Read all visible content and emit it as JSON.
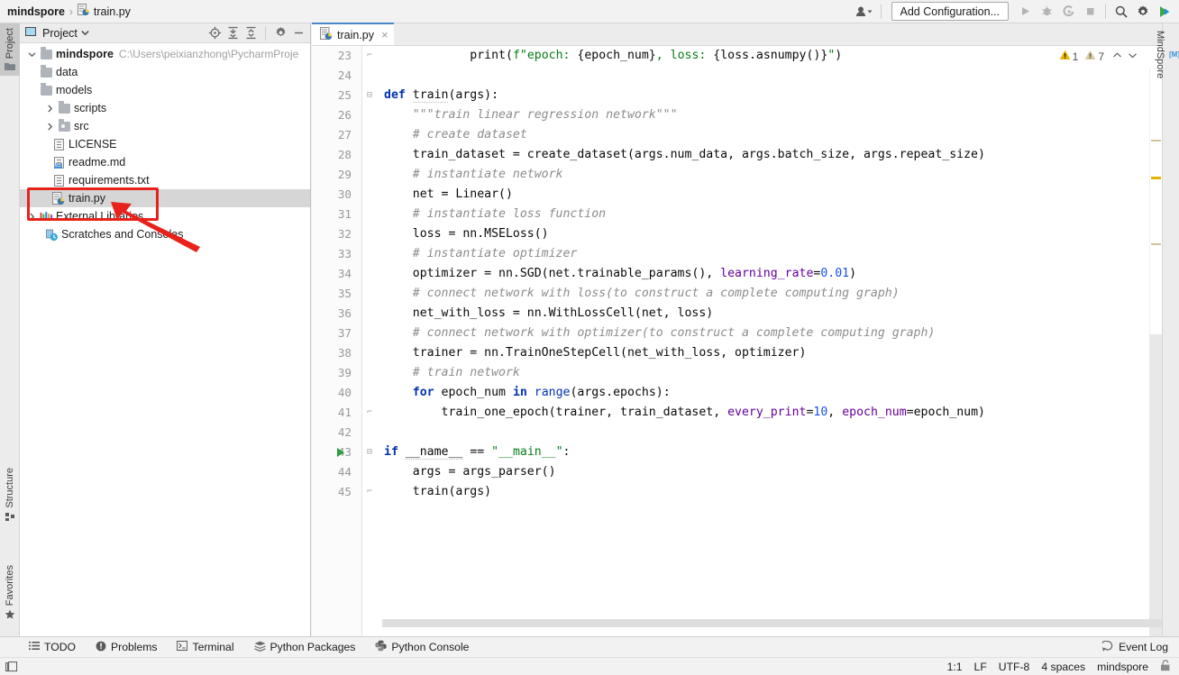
{
  "window": {
    "breadcrumb_project": "mindspore",
    "breadcrumb_sep": "›",
    "breadcrumb_file": "train.py"
  },
  "toolbar": {
    "user_icon": "user-account-icon",
    "add_configuration": "Add Configuration...",
    "run_icon": "run-icon",
    "debug_icon": "debug-icon",
    "run_coverage_icon": "run-with-coverage-icon",
    "stop_icon": "stop-icon",
    "search_icon": "search-icon",
    "settings_icon": "gear-icon",
    "updates_icon": "ide-update-icon"
  },
  "left_strip": {
    "project": "Project",
    "structure": "Structure",
    "favorites": "Favorites"
  },
  "right_strip": {
    "mindspore": "MindSpore",
    "badge": "[M]"
  },
  "project_panel": {
    "title": "Project",
    "dropdown_icon": "chevron-down-icon",
    "tools": [
      "locate-icon",
      "expand-all-icon",
      "collapse-all-icon",
      "gear-icon",
      "hide-icon"
    ],
    "tree": [
      {
        "label": "mindspore",
        "path": "C:\\Users\\peixianzhong\\PycharmProje",
        "icon": "folder-icon",
        "indent": 0,
        "twist": "expanded",
        "bold": true,
        "selected": false
      },
      {
        "label": "data",
        "path": "",
        "icon": "folder-icon",
        "indent": 1,
        "twist": "none",
        "bold": false,
        "selected": false
      },
      {
        "label": "models",
        "path": "",
        "icon": "folder-icon",
        "indent": 1,
        "twist": "none",
        "bold": false,
        "selected": false
      },
      {
        "label": "scripts",
        "path": "",
        "icon": "folder-icon",
        "indent": 1,
        "twist": "collapsed",
        "bold": false,
        "selected": false
      },
      {
        "label": "src",
        "path": "",
        "icon": "source-folder-icon",
        "indent": 1,
        "twist": "collapsed",
        "bold": false,
        "selected": false
      },
      {
        "label": "LICENSE",
        "path": "",
        "icon": "text-file-icon",
        "indent": 1,
        "twist": "none",
        "bold": false,
        "selected": false
      },
      {
        "label": "readme.md",
        "path": "",
        "icon": "markdown-file-icon",
        "indent": 1,
        "twist": "none",
        "bold": false,
        "selected": false
      },
      {
        "label": "requirements.txt",
        "path": "",
        "icon": "text-file-icon",
        "indent": 1,
        "twist": "none",
        "bold": false,
        "selected": false
      },
      {
        "label": "train.py",
        "path": "",
        "icon": "python-file-icon",
        "indent": 1,
        "twist": "none",
        "bold": false,
        "selected": true
      },
      {
        "label": "External Libraries",
        "path": "",
        "icon": "external-libraries-icon",
        "indent": 0,
        "twist": "collapsed",
        "bold": false,
        "selected": false
      },
      {
        "label": "Scratches and Consoles",
        "path": "",
        "icon": "scratches-icon",
        "indent": 0,
        "twist": "none",
        "bold": false,
        "selected": false
      }
    ]
  },
  "annotation": {
    "highlight_color": "#e8221b",
    "target": "train.py"
  },
  "editor": {
    "tab_label": "train.py",
    "tab_icon": "python-file-icon",
    "tab_close": "×",
    "inspection": {
      "error_count": "1",
      "warning_count": "7",
      "up_icon": "⌃",
      "down_icon": "⌄"
    },
    "lines": [
      {
        "num": "23",
        "fold": "end",
        "run": false,
        "text": "            print(f\"epoch: {epoch_num}, loss: {loss.asnumpy()}\")"
      },
      {
        "num": "24",
        "fold": "",
        "run": false,
        "text": ""
      },
      {
        "num": "25",
        "fold": "start",
        "run": false,
        "text": "def train(args):"
      },
      {
        "num": "26",
        "fold": "",
        "run": false,
        "text": "    \"\"\"train linear regression network\"\"\""
      },
      {
        "num": "27",
        "fold": "",
        "run": false,
        "text": "    # create dataset"
      },
      {
        "num": "28",
        "fold": "",
        "run": false,
        "text": "    train_dataset = create_dataset(args.num_data, args.batch_size, args.repeat_size)"
      },
      {
        "num": "29",
        "fold": "",
        "run": false,
        "text": "    # instantiate network"
      },
      {
        "num": "30",
        "fold": "",
        "run": false,
        "text": "    net = Linear()"
      },
      {
        "num": "31",
        "fold": "",
        "run": false,
        "text": "    # instantiate loss function"
      },
      {
        "num": "32",
        "fold": "",
        "run": false,
        "text": "    loss = nn.MSELoss()"
      },
      {
        "num": "33",
        "fold": "",
        "run": false,
        "text": "    # instantiate optimizer"
      },
      {
        "num": "34",
        "fold": "",
        "run": false,
        "text": "    optimizer = nn.SGD(net.trainable_params(), learning_rate=0.01)"
      },
      {
        "num": "35",
        "fold": "",
        "run": false,
        "text": "    # connect network with loss(to construct a complete computing graph)"
      },
      {
        "num": "36",
        "fold": "",
        "run": false,
        "text": "    net_with_loss = nn.WithLossCell(net, loss)"
      },
      {
        "num": "37",
        "fold": "",
        "run": false,
        "text": "    # connect network with optimizer(to construct a complete computing graph)"
      },
      {
        "num": "38",
        "fold": "",
        "run": false,
        "text": "    trainer = nn.TrainOneStepCell(net_with_loss, optimizer)"
      },
      {
        "num": "39",
        "fold": "",
        "run": false,
        "text": "    # train network"
      },
      {
        "num": "40",
        "fold": "",
        "run": false,
        "text": "    for epoch_num in range(args.epochs):"
      },
      {
        "num": "41",
        "fold": "end",
        "run": false,
        "text": "        train_one_epoch(trainer, train_dataset, every_print=10, epoch_num=epoch_num)"
      },
      {
        "num": "42",
        "fold": "",
        "run": false,
        "text": ""
      },
      {
        "num": "43",
        "fold": "start",
        "run": true,
        "text": "if __name__ == \"__main__\":"
      },
      {
        "num": "44",
        "fold": "",
        "run": false,
        "text": "    args = args_parser()"
      },
      {
        "num": "45",
        "fold": "end",
        "run": false,
        "text": "    train(args)"
      }
    ]
  },
  "bottom_bar": {
    "items": [
      {
        "label": "TODO",
        "icon": "todo-icon"
      },
      {
        "label": "Problems",
        "icon": "problems-icon"
      },
      {
        "label": "Terminal",
        "icon": "terminal-icon"
      },
      {
        "label": "Python Packages",
        "icon": "packages-icon"
      },
      {
        "label": "Python Console",
        "icon": "python-console-icon"
      }
    ],
    "event_log": "Event Log",
    "event_log_icon": "event-log-icon"
  },
  "status_bar": {
    "left_icon": "toggle-toolbars-icon",
    "caret": "1:1",
    "line_separator": "LF",
    "encoding": "UTF-8",
    "indent": "4 spaces",
    "branch": "mindspore",
    "lock_icon": "lock-icon"
  }
}
